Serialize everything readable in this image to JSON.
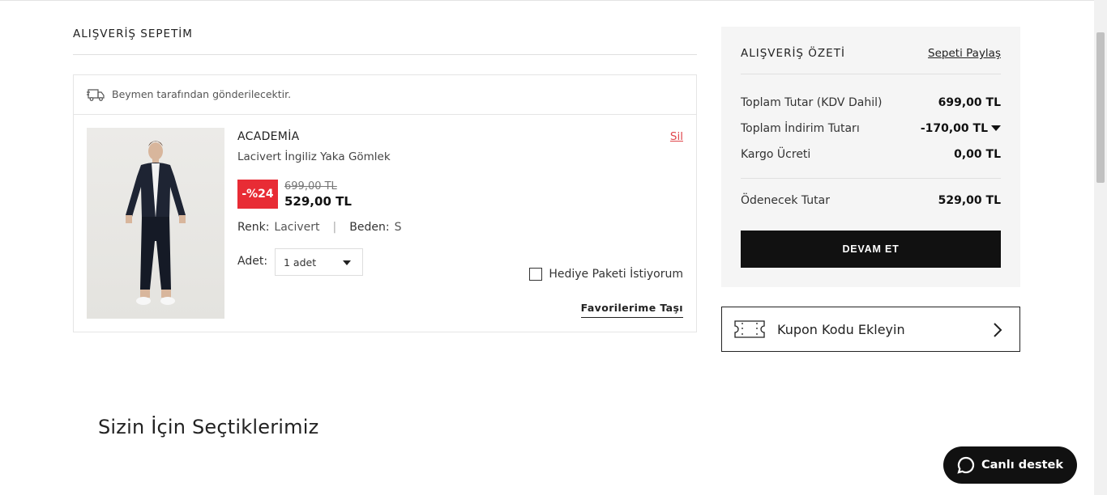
{
  "cart": {
    "title": "ALIŞVERİŞ SEPETİM",
    "shipping_note": "Beymen tarafından gönderilecektir.",
    "item": {
      "brand": "ACADEMİA",
      "name": "Lacivert İngiliz Yaka Gömlek",
      "delete_label": "Sil",
      "discount_badge": "-%24",
      "old_price": "699,00 TL",
      "new_price": "529,00 TL",
      "color_label": "Renk:",
      "color_value": "Lacivert",
      "size_label": "Beden:",
      "size_value": "S",
      "qty_label": "Adet:",
      "qty_value": "1 adet",
      "gift_label": "Hediye Paketi İstiyorum",
      "gift_checked": false,
      "favorite_label": "Favorilerime Taşı"
    }
  },
  "recommendations": {
    "title": "Sizin İçin Seçtiklerimiz"
  },
  "summary": {
    "title": "ALIŞVERİŞ ÖZETİ",
    "share_label": "Sepeti Paylaş",
    "rows": [
      {
        "label": "Toplam Tutar (KDV Dahil)",
        "amount": "699,00 TL"
      },
      {
        "label": "Toplam İndirim Tutarı",
        "amount": "-170,00 TL"
      },
      {
        "label": "Kargo Ücreti",
        "amount": "0,00 TL"
      }
    ],
    "total_label": "Ödenecek Tutar",
    "total_amount": "529,00 TL",
    "continue_label": "DEVAM ET"
  },
  "coupon": {
    "label": "Kupon Kodu Ekleyin"
  },
  "support": {
    "label": "Canlı destek"
  },
  "colors": {
    "discount": "#e82c35",
    "delete_link": "#e0474c",
    "primary": "#111111",
    "summary_bg": "#f5f5f5"
  },
  "icons": [
    "truck-icon",
    "ticket-icon",
    "chevron-right-icon",
    "chat-icon",
    "caret-down-icon"
  ]
}
